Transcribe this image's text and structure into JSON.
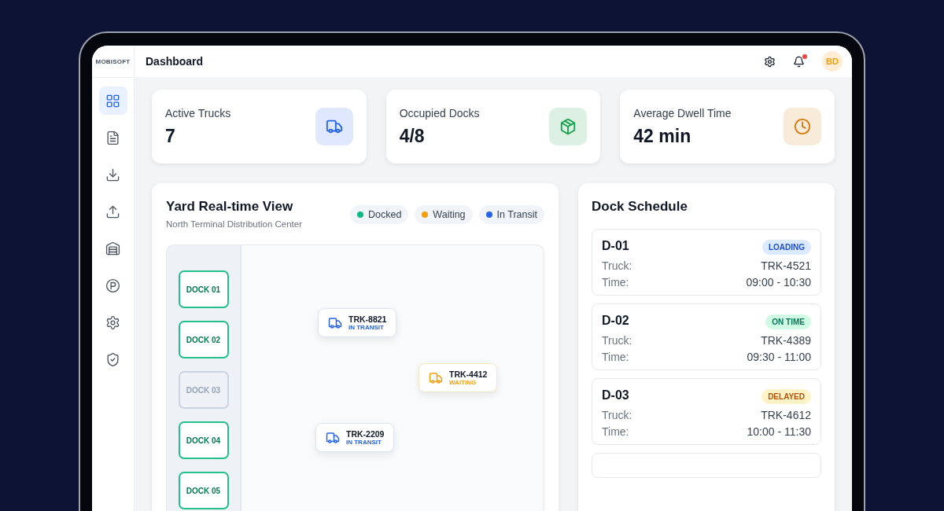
{
  "brand": {
    "logo": "MOBISOFT"
  },
  "header": {
    "title": "Dashboard",
    "avatar": "BD",
    "notification_unread": true
  },
  "sidebar": {
    "items": [
      {
        "selected": true
      },
      {
        "selected": false
      },
      {
        "selected": false
      },
      {
        "selected": false
      },
      {
        "selected": false
      },
      {
        "selected": false
      },
      {
        "selected": false
      },
      {
        "selected": false
      }
    ]
  },
  "stats": [
    {
      "label": "Active Trucks",
      "value": "7",
      "color": "#2563eb"
    },
    {
      "label": "Occupied Docks",
      "value": "4/8",
      "color": "#16a34a"
    },
    {
      "label": "Average Dwell Time",
      "value": "42 min",
      "color": "#d97706"
    }
  ],
  "yard": {
    "title": "Yard Real-time View",
    "subtitle": "North Terminal Distribution Center",
    "legend": [
      {
        "label": "Docked",
        "color": "#10b981"
      },
      {
        "label": "Waiting",
        "color": "#f59e0b"
      },
      {
        "label": "In Transit",
        "color": "#2563eb"
      }
    ],
    "docks": [
      {
        "label": "DOCK 01",
        "occupied": true
      },
      {
        "label": "DOCK 02",
        "occupied": true
      },
      {
        "label": "DOCK 03",
        "occupied": false
      },
      {
        "label": "DOCK 04",
        "occupied": true
      },
      {
        "label": "DOCK 05",
        "occupied": true
      }
    ],
    "trucks": [
      {
        "id": "TRK-8821",
        "status": "IN TRANSIT",
        "kind": "transit"
      },
      {
        "id": "TRK-4412",
        "status": "WAITING",
        "kind": "waiting"
      },
      {
        "id": "TRK-2209",
        "status": "IN TRANSIT",
        "kind": "transit"
      }
    ]
  },
  "schedule": {
    "title": "Dock Schedule",
    "items": [
      {
        "dock": "D-01",
        "status": "LOADING",
        "kind": "loading",
        "truck_label": "Truck:",
        "truck": "TRK-4521",
        "time_label": "Time:",
        "time": "09:00 - 10:30"
      },
      {
        "dock": "D-02",
        "status": "ON TIME",
        "kind": "ontime",
        "truck_label": "Truck:",
        "truck": "TRK-4389",
        "time_label": "Time:",
        "time": "09:30 - 11:00"
      },
      {
        "dock": "D-03",
        "status": "DELAYED",
        "kind": "delayed",
        "truck_label": "Truck:",
        "truck": "TRK-4612",
        "time_label": "Time:",
        "time": "10:00 - 11:30"
      }
    ]
  }
}
